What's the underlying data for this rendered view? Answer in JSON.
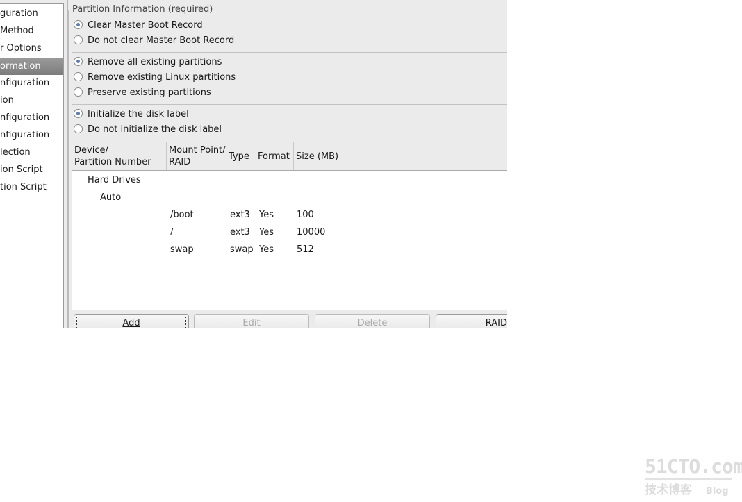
{
  "sidebar": {
    "items": [
      "guration",
      "Method",
      "r Options",
      "ormation",
      "nfiguration",
      "ion",
      "nfiguration",
      "nfiguration",
      "lection",
      "ion Script",
      "tion Script"
    ],
    "selected_index": 3
  },
  "panel": {
    "legend": "Partition Information (required)",
    "mbr": [
      {
        "label": "Clear Master Boot Record",
        "checked": true
      },
      {
        "label": "Do not clear Master Boot Record",
        "checked": false
      }
    ],
    "partitions": [
      {
        "label": "Remove all existing partitions",
        "checked": true
      },
      {
        "label": "Remove existing Linux partitions",
        "checked": false
      },
      {
        "label": "Preserve existing partitions",
        "checked": false
      }
    ],
    "disklabel": [
      {
        "label": "Initialize the disk label",
        "checked": true
      },
      {
        "label": "Do not initialize the disk label",
        "checked": false
      }
    ]
  },
  "table": {
    "headers": [
      "Device/\nPartition Number",
      "Mount Point/\nRAID",
      "Type",
      "Format",
      "Size (MB)"
    ],
    "tree": {
      "root": "Hard Drives",
      "child": "Auto"
    },
    "rows": [
      [
        "/boot",
        "ext3",
        "Yes",
        "100"
      ],
      [
        "/",
        "ext3",
        "Yes",
        "10000"
      ],
      [
        "swap",
        "swap",
        "Yes",
        "512"
      ]
    ]
  },
  "buttons": {
    "add": "Add",
    "edit": "Edit",
    "delete": "Delete",
    "raid": "RAID"
  },
  "watermark": {
    "line1": "51CTO.com",
    "line2": "技术博客",
    "line3": "Blog"
  }
}
